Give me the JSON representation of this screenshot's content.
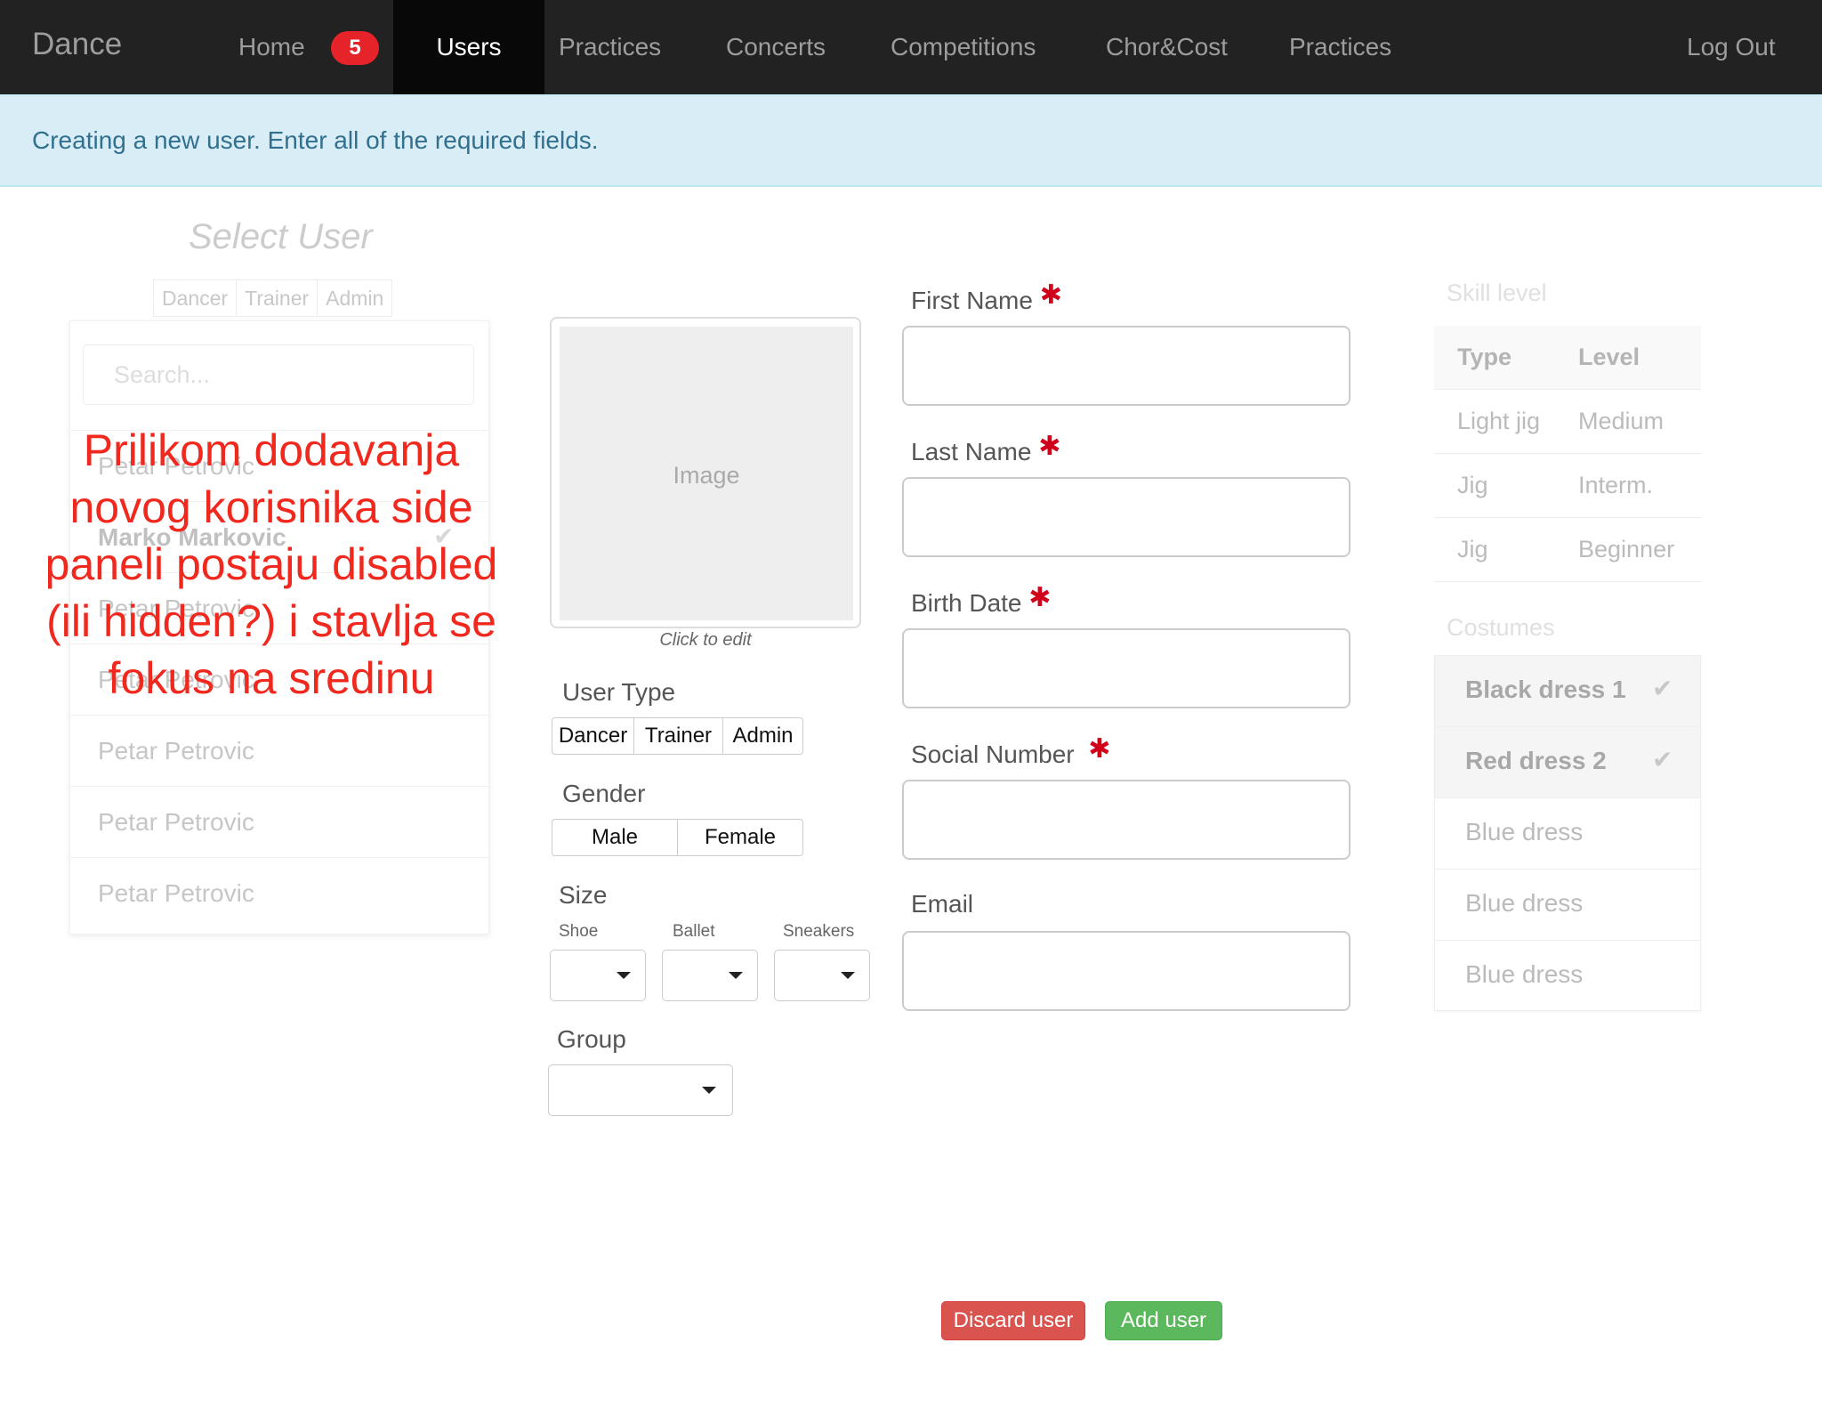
{
  "navbar": {
    "brand": "Dance",
    "badge": "5",
    "items": [
      {
        "label": "Home"
      },
      {
        "label": "Users"
      },
      {
        "label": "Practices"
      },
      {
        "label": "Concerts"
      },
      {
        "label": "Competitions"
      },
      {
        "label": "Chor&Cost"
      },
      {
        "label": "Practices"
      }
    ],
    "logout": "Log Out"
  },
  "alert": "Creating a new user. Enter all of the required fields.",
  "left_panel": {
    "title": "Select User",
    "filters": [
      "Dancer",
      "Trainer",
      "Admin"
    ],
    "search_placeholder": "Search...",
    "users": [
      "Petar Petrovic",
      "Marko Markovic",
      "Petar Petrovic",
      "Petar Petrovic",
      "Petar Petrovic",
      "Petar Petrovic",
      "Petar Petrovic"
    ],
    "selected_check": "✔"
  },
  "annotation": "Prilikom dodavanja novog korisnika side paneli postaju disabled (ili hidden?) i stavlja se fokus na sredinu",
  "image": {
    "placeholder": "Image",
    "caption": "Click to edit"
  },
  "user_type": {
    "label": "User Type",
    "options": [
      "Dancer",
      "Trainer",
      "Admin"
    ]
  },
  "gender": {
    "label": "Gender",
    "options": [
      "Male",
      "Female"
    ]
  },
  "size": {
    "label": "Size",
    "shoe": "Shoe",
    "ballet": "Ballet",
    "sneakers": "Sneakers"
  },
  "group": {
    "label": "Group"
  },
  "form": {
    "required_mark": "✱",
    "first_name": "First Name",
    "last_name": "Last Name",
    "birth_date": "Birth Date",
    "social_number": "Social Number",
    "email": "Email"
  },
  "skill": {
    "title": "Skill level",
    "headers": [
      "Type",
      "Level"
    ],
    "rows": [
      {
        "type": "Light jig",
        "level": "Medium"
      },
      {
        "type": "Jig",
        "level": "Interm."
      },
      {
        "type": "Jig",
        "level": "Beginner"
      }
    ]
  },
  "costumes": {
    "title": "Costumes",
    "items": [
      {
        "label": "Black dress 1",
        "selected": true
      },
      {
        "label": "Red dress 2",
        "selected": true
      },
      {
        "label": "Blue dress",
        "selected": false
      },
      {
        "label": "Blue dress",
        "selected": false
      },
      {
        "label": "Blue dress",
        "selected": false
      }
    ]
  },
  "actions": {
    "discard": "Discard user",
    "add": "Add user"
  },
  "colors": {
    "navbar": "#222222",
    "alert_bg": "#d9edf7",
    "alert_text": "#31708f",
    "badge": "#e7232a",
    "danger": "#d9534f",
    "success": "#5cb85c",
    "required": "#d0021b",
    "annotation": "#f0281e"
  }
}
